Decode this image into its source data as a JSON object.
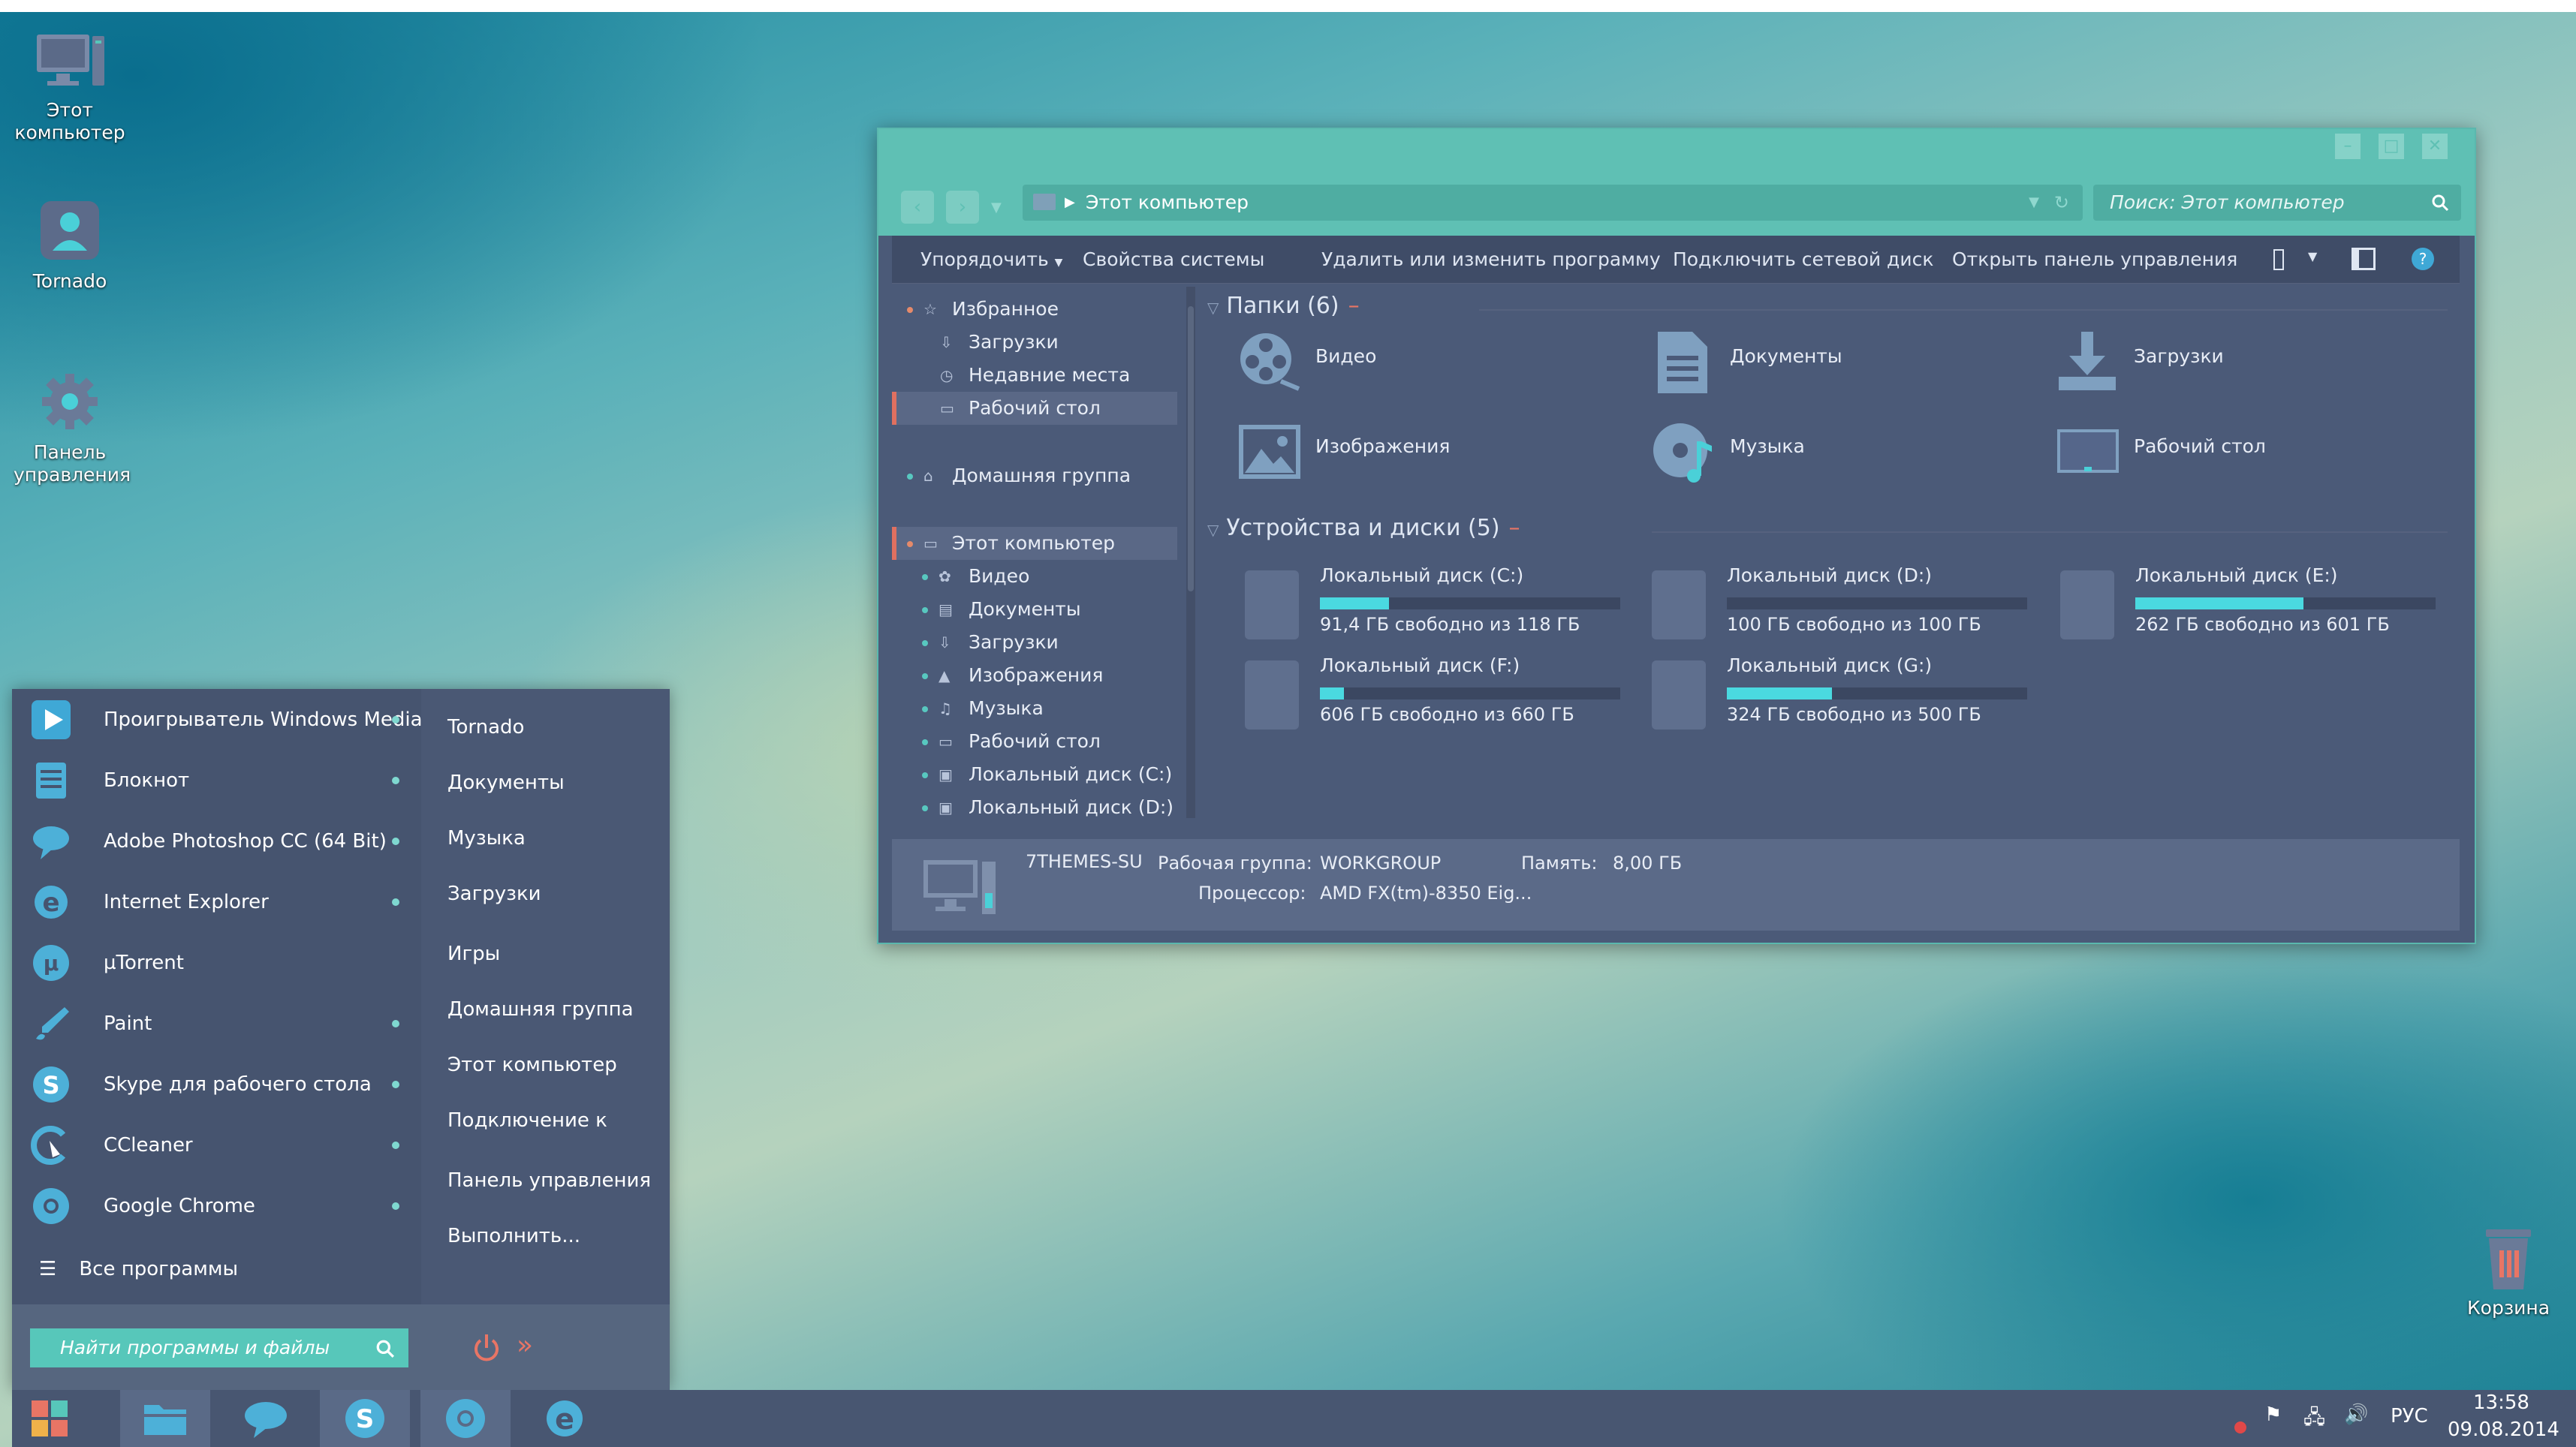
{
  "desktop": {
    "icons": [
      {
        "label_line1": "Этот",
        "label_line2": "компьютер"
      },
      {
        "label_line1": "Tornado",
        "label_line2": ""
      },
      {
        "label_line1": "Панель",
        "label_line2": "управления"
      }
    ],
    "recycle_bin": "Корзина"
  },
  "explorer": {
    "address": "Этот компьютер",
    "search_placeholder": "Поиск: Этот компьютер",
    "toolbar": {
      "organize": "Упорядочить",
      "system_properties": "Свойства системы",
      "uninstall": "Удалить или изменить программу",
      "map_drive": "Подключить сетевой диск",
      "open_control_panel": "Открыть панель управления"
    },
    "nav": [
      {
        "label": "Избранное"
      },
      {
        "label": "Загрузки"
      },
      {
        "label": "Недавние места"
      },
      {
        "label": "Рабочий стол"
      },
      {
        "label": "Домашняя группа"
      },
      {
        "label": "Этот компьютер"
      },
      {
        "label": "Видео"
      },
      {
        "label": "Документы"
      },
      {
        "label": "Загрузки"
      },
      {
        "label": "Изображения"
      },
      {
        "label": "Музыка"
      },
      {
        "label": "Рабочий стол"
      },
      {
        "label": "Локальный диск (C:)"
      },
      {
        "label": "Локальный диск (D:)"
      }
    ],
    "folders_header": "Папки (6)",
    "folders": [
      {
        "label": "Видео",
        "icon": "film-reel-icon"
      },
      {
        "label": "Документы",
        "icon": "document-icon"
      },
      {
        "label": "Загрузки",
        "icon": "download-icon"
      },
      {
        "label": "Изображения",
        "icon": "pictures-icon"
      },
      {
        "label": "Музыка",
        "icon": "music-icon"
      },
      {
        "label": "Рабочий стол",
        "icon": "desktop-icon"
      }
    ],
    "devices_header": "Устройства и диски (5)",
    "drives": [
      {
        "name": "Локальный диск (C:)",
        "free": "91,4 ГБ свободно из 118 ГБ",
        "used_fraction": 0.23
      },
      {
        "name": "Локальный диск (D:)",
        "free": "100 ГБ свободно из 100 ГБ",
        "used_fraction": 0.0
      },
      {
        "name": "Локальный диск (E:)",
        "free": "262 ГБ свободно из 601 ГБ",
        "used_fraction": 0.56
      },
      {
        "name": "Локальный диск (F:)",
        "free": "606 ГБ свободно из 660 ГБ",
        "used_fraction": 0.08
      },
      {
        "name": "Локальный диск (G:)",
        "free": "324 ГБ свободно из 500 ГБ",
        "used_fraction": 0.35
      }
    ],
    "details": {
      "computer_name": "7THEMES-SU",
      "workgroup_label": "Рабочая группа:",
      "workgroup_value": "WORKGROUP",
      "memory_label": "Память:",
      "memory_value": "8,00 ГБ",
      "cpu_label": "Процессор:",
      "cpu_value": "AMD FX(tm)-8350 Eig..."
    }
  },
  "start_menu": {
    "programs": [
      {
        "label": "Проигрыватель Windows Media",
        "color": "#3fa8d6"
      },
      {
        "label": "Блокнот",
        "color": "#4db0d8"
      },
      {
        "label": "Adobe Photoshop CC (64 Bit)",
        "color": "#4db0d8"
      },
      {
        "label": "Internet Explorer",
        "color": "#4db0d8"
      },
      {
        "label": "µTorrent",
        "color": "#4db0d8"
      },
      {
        "label": "Paint",
        "color": "#4db0d8"
      },
      {
        "label": "Skype для рабочего стола",
        "color": "#4db0d8"
      },
      {
        "label": "CCleaner",
        "color": "#4db0d8"
      },
      {
        "label": "Google Chrome",
        "color": "#4db0d8"
      }
    ],
    "all_programs": "Все программы",
    "right": [
      "Tornado",
      "Документы",
      "Музыка",
      "Загрузки",
      "Игры",
      "Домашняя группа",
      "Этот компьютер",
      "Подключение к",
      "Панель управления",
      "Выполнить..."
    ],
    "search_placeholder": "Найти программы и файлы"
  },
  "taskbar": {
    "language": "РУС",
    "time": "13:58",
    "date": "09.08.2014"
  },
  "colors": {
    "accent": "#5fc0b4",
    "panel": "#4b5a78",
    "bar_fill": "#4ad9e0",
    "highlight": "#e07060"
  }
}
